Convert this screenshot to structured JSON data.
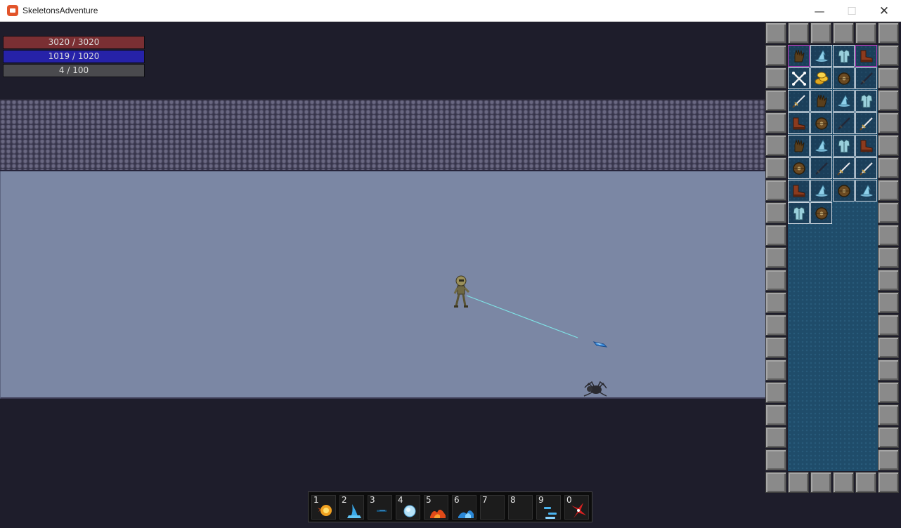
{
  "window": {
    "title": "SkeletonsAdventure",
    "controls": {
      "minimize": "—",
      "maximize": "☐",
      "close": "✕"
    }
  },
  "hud": {
    "health": "3020 / 3020",
    "mana": "1019 / 1020",
    "experience": "4 / 100"
  },
  "inventory": {
    "columns": 4,
    "items": [
      {
        "icon": "gloves-icon",
        "equipped": true
      },
      {
        "icon": "wizard-hat-icon",
        "equipped": false
      },
      {
        "icon": "chest-armor-icon",
        "equipped": false
      },
      {
        "icon": "boots-icon",
        "equipped": true
      },
      {
        "icon": "crossed-bones-icon",
        "equipped": false
      },
      {
        "icon": "gold-coins-icon",
        "equipped": false
      },
      {
        "icon": "round-shield-icon",
        "equipped": false
      },
      {
        "icon": "dark-sword-icon",
        "equipped": false
      },
      {
        "icon": "sword-icon",
        "equipped": false
      },
      {
        "icon": "gloves-icon",
        "equipped": false
      },
      {
        "icon": "wizard-hat-icon",
        "equipped": false
      },
      {
        "icon": "chest-armor-icon",
        "equipped": false
      },
      {
        "icon": "boots-icon",
        "equipped": false
      },
      {
        "icon": "round-shield-icon",
        "equipped": false
      },
      {
        "icon": "dark-sword-icon",
        "equipped": false
      },
      {
        "icon": "sword-icon",
        "equipped": false
      },
      {
        "icon": "gloves-icon",
        "equipped": false
      },
      {
        "icon": "wizard-hat-icon",
        "equipped": false
      },
      {
        "icon": "chest-armor-icon",
        "equipped": false
      },
      {
        "icon": "boots-icon",
        "equipped": false
      },
      {
        "icon": "round-shield-icon",
        "equipped": false
      },
      {
        "icon": "dark-sword-icon",
        "equipped": false
      },
      {
        "icon": "sword-icon",
        "equipped": false
      },
      {
        "icon": "sword-icon",
        "equipped": false
      },
      {
        "icon": "boots-icon",
        "equipped": false
      },
      {
        "icon": "wizard-hat-icon",
        "equipped": false
      },
      {
        "icon": "round-shield-icon",
        "equipped": false
      },
      {
        "icon": "wizard-hat-icon",
        "equipped": false
      },
      {
        "icon": "chest-armor-icon",
        "equipped": false
      },
      {
        "icon": "round-shield-icon",
        "equipped": false
      }
    ]
  },
  "hotbar": [
    {
      "key": "1",
      "spell": "fireball-icon"
    },
    {
      "key": "2",
      "spell": "water-spout-icon"
    },
    {
      "key": "3",
      "spell": "dark-bolt-icon"
    },
    {
      "key": "4",
      "spell": "ice-orb-icon"
    },
    {
      "key": "5",
      "spell": "fire-wave-icon"
    },
    {
      "key": "6",
      "spell": "water-wave-icon"
    },
    {
      "key": "7",
      "spell": ""
    },
    {
      "key": "8",
      "spell": ""
    },
    {
      "key": "9",
      "spell": "ice-dash-icon"
    },
    {
      "key": "0",
      "spell": "red-vortex-icon"
    }
  ],
  "colors": {
    "health": "#7a2f33",
    "mana": "#2622a8",
    "experience": "#4a4a4e",
    "room_floor": "#7b87a4",
    "beam": "#7fe3e6",
    "equipped_border": "#c040c0"
  }
}
